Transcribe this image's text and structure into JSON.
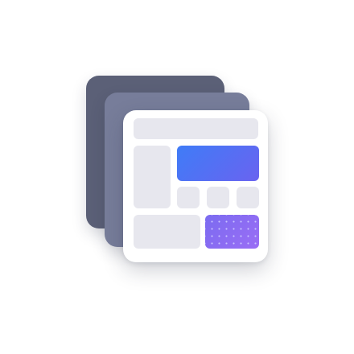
{
  "illustration": {
    "kind": "layered-layout-template-icon",
    "colors": {
      "back_sheet": "#5b6077",
      "middle_sheet": "#777d9a",
      "front_sheet": "#ffffff",
      "placeholder_tile": "#e7e7ee",
      "hero_gradient_start": "#3f7cf7",
      "hero_gradient_end": "#6a63f0",
      "dotted_tile_start": "#7b6cf0",
      "dotted_tile_end": "#9a6df5",
      "dot": "#c8c2ff"
    }
  }
}
